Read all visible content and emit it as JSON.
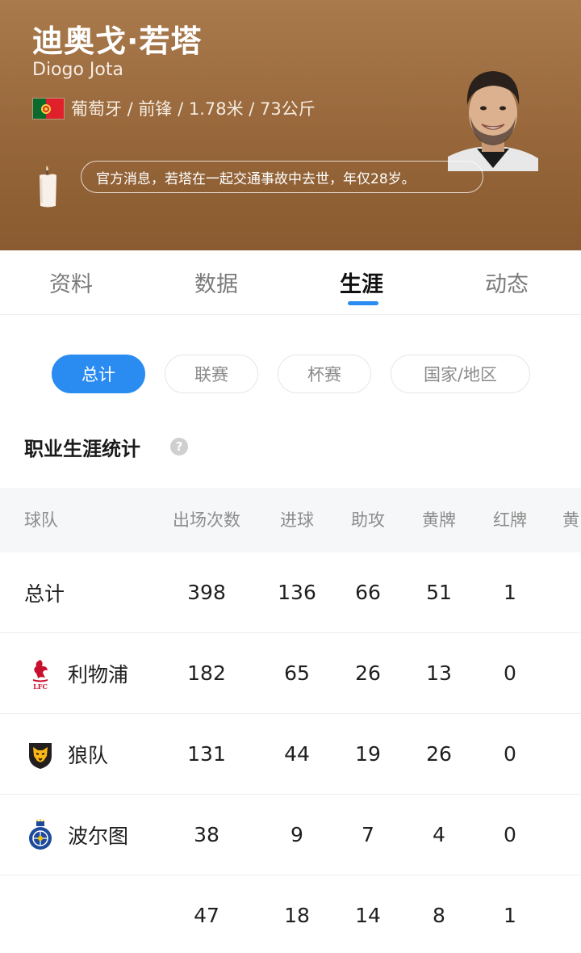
{
  "player": {
    "name_cn": "迪奥戈·若塔",
    "name_en": "Diogo Jota",
    "info": "葡萄牙 / 前锋 / 1.78米 / 73公斤",
    "news": "官方消息，若塔在一起交通事故中去世，年仅28岁。"
  },
  "tabs": [
    {
      "label": "资料",
      "active": false
    },
    {
      "label": "数据",
      "active": false
    },
    {
      "label": "生涯",
      "active": true
    },
    {
      "label": "动态",
      "active": false
    }
  ],
  "filters": [
    {
      "label": "总计",
      "active": true
    },
    {
      "label": "联赛",
      "active": false
    },
    {
      "label": "杯赛",
      "active": false
    },
    {
      "label": "国家/地区",
      "active": false
    }
  ],
  "section": {
    "title": "职业生涯统计",
    "help": "?"
  },
  "table": {
    "headers": [
      "球队",
      "出场次数",
      "进球",
      "助攻",
      "黄牌",
      "红牌",
      "黄"
    ],
    "rows": [
      {
        "team": "总计",
        "logo": "",
        "values": [
          "398",
          "136",
          "66",
          "51",
          "1"
        ]
      },
      {
        "team": "利物浦",
        "logo": "liverpool-logo-icon",
        "values": [
          "182",
          "65",
          "26",
          "13",
          "0"
        ]
      },
      {
        "team": "狼队",
        "logo": "wolves-logo-icon",
        "values": [
          "131",
          "44",
          "19",
          "26",
          "0"
        ]
      },
      {
        "team": "波尔图",
        "logo": "porto-logo-icon",
        "values": [
          "38",
          "9",
          "7",
          "4",
          "0"
        ]
      },
      {
        "team": "",
        "logo": "",
        "values": [
          "47",
          "18",
          "14",
          "8",
          "1"
        ]
      }
    ]
  },
  "colors": {
    "header_bg": "#97673b",
    "accent": "#2a8cf0"
  }
}
